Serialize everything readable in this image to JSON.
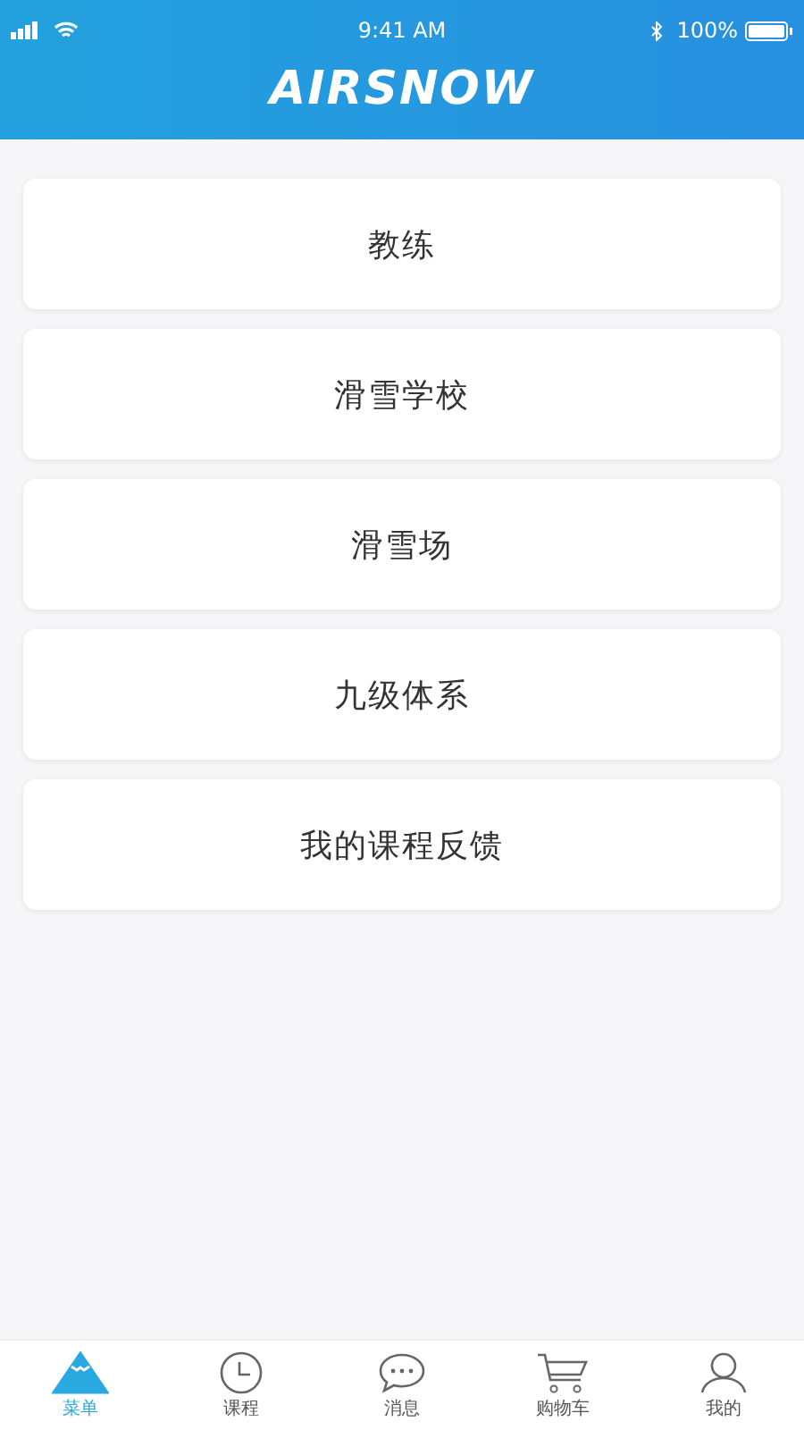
{
  "status_bar": {
    "time": "9:41 AM",
    "battery": "100%"
  },
  "header": {
    "logo": "AIRSNOW"
  },
  "menu_items": [
    "教练",
    "滑雪学校",
    "滑雪场",
    "九级体系",
    "我的课程反馈"
  ],
  "tab_bar": [
    {
      "label": "菜单",
      "selected": true
    },
    {
      "label": "课程",
      "selected": false
    },
    {
      "label": "消息",
      "selected": false
    },
    {
      "label": "购物车",
      "selected": false
    },
    {
      "label": "我的",
      "selected": false
    }
  ]
}
